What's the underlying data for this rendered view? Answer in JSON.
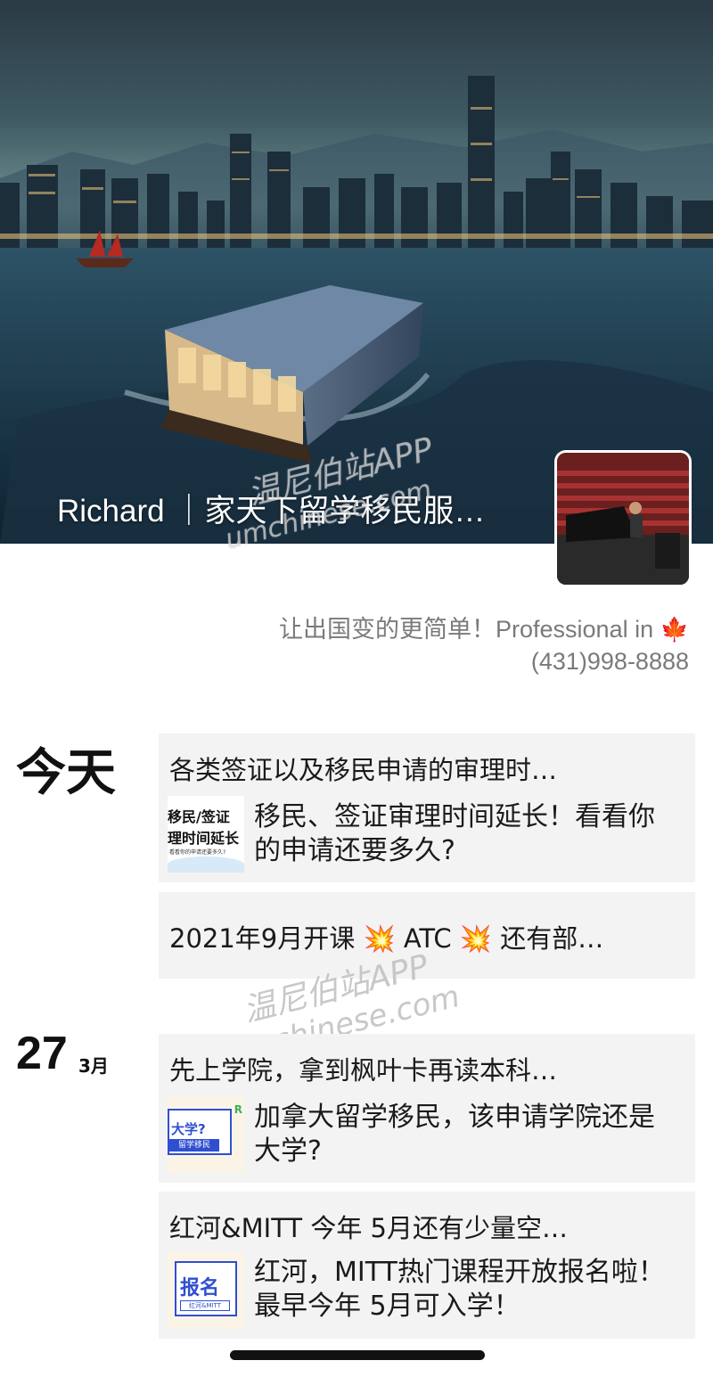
{
  "profile": {
    "cover_name": "Richard ｜家天下留学移民服…",
    "bio_line1": "让出国变的更简单！Professional in",
    "bio_icon": "maple-leaf-icon",
    "bio_line2": "(431)998-8888"
  },
  "watermark": {
    "line1": "温尼伯站APP",
    "line2": "umchinese.com"
  },
  "feed": {
    "today_label": "今天",
    "date_day": "27",
    "date_month": "3月",
    "posts": [
      {
        "title": "各类签证以及移民申请的审理时…",
        "thumb_text_1": "移民/签证",
        "thumb_text_2": "理时间延长",
        "thumb_text_3": "看看你的申请还要多久?",
        "description": "移民、签证审理时间延长！看看你的申请还要多久?"
      },
      {
        "title_part1": "2021年9月开课",
        "title_part2": "ATC",
        "title_part3": "还有部…"
      },
      {
        "title": "先上学院，拿到枫叶卡再读本科…",
        "thumb_text_1": "大学?",
        "thumb_text_2": "留学移民",
        "description": "加拿大留学移民，该申请学院还是大学?"
      },
      {
        "title": "红河&MITT 今年 5月还有少量空…",
        "thumb_text_1": "报名",
        "thumb_text_2": "红河&MITT",
        "description": "红河，MITT热门课程开放报名啦！最早今年 5月可入学！"
      }
    ]
  },
  "colors": {
    "card_bg": "#f3f3f3",
    "bio_text": "#7a7a7a",
    "accent_blue": "#2f4fd1"
  }
}
